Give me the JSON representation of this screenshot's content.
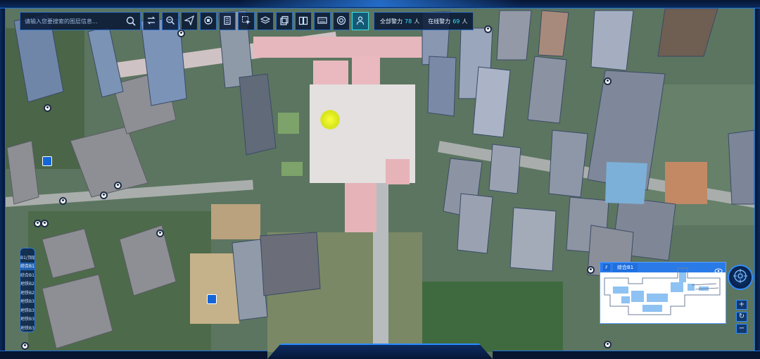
{
  "toolbar": {
    "search_placeholder": "请输入您要搜索的图层信息...",
    "tools": [
      {
        "name": "swap-icon"
      },
      {
        "name": "zoom-search-icon"
      },
      {
        "name": "send-icon"
      },
      {
        "name": "video-icon"
      },
      {
        "name": "building-icon"
      },
      {
        "name": "select-icon"
      },
      {
        "name": "layers-icon"
      },
      {
        "name": "copy-icon"
      },
      {
        "name": "book-icon"
      },
      {
        "name": "keyboard-icon"
      },
      {
        "name": "target-icon"
      },
      {
        "name": "person-icon"
      }
    ],
    "status": {
      "total_label": "全部警力",
      "total_value": "78",
      "total_unit": "人",
      "online_label": "在线警力",
      "online_value": "69",
      "online_unit": "人"
    }
  },
  "floors": {
    "items": [
      "B1/顶层",
      "综合B1",
      "综合B1",
      "地铁B2",
      "地铁B2",
      "地铁B3",
      "地铁B3",
      "地铁B3",
      "地铁B3"
    ],
    "selected_index": 1
  },
  "minimap": {
    "badge": "F",
    "title": "综合B1"
  },
  "zoom": {
    "plus": "+",
    "reset": "↻",
    "minus": "−"
  },
  "colors": {
    "frame": "#0b2a5a",
    "accent": "#2f8cff",
    "highlight": "#35e3ff"
  }
}
